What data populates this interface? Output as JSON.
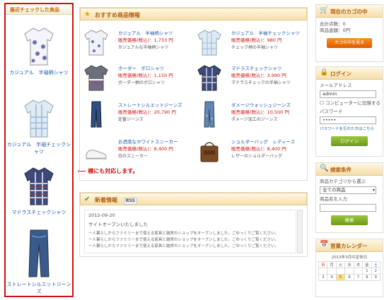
{
  "left_column": {
    "title": "最近チェックした商品",
    "items": [
      {
        "label": "カジュアル　半袖柄シャツ"
      },
      {
        "label": "カジュアル　半袖チェックシャツ"
      },
      {
        "label": "マドラスチェックシャツ"
      },
      {
        "label": "ストレートシルエットジーンズ"
      }
    ]
  },
  "annotation": "横にも対応します。",
  "recommend": {
    "title": "おすすめ商品情報",
    "products": [
      {
        "name": "カジュアル　半袖柄シャツ",
        "price": "販売価格(税込)：1,733 円",
        "desc": "カジュアルな半袖柄シャツ",
        "thumb": "shirt-white"
      },
      {
        "name": "カジュアル　半袖チェックシャツ",
        "price": "販売価格(税込)：980 円",
        "desc": "チェック柄の半袖シャツ",
        "thumb": "shirt-check-blue"
      },
      {
        "name": "ボーダー　ポロシャツ",
        "price": "販売価格(税込)：1,150 円",
        "desc": "ボーダー柄のポロシャツ",
        "thumb": "polo-gray"
      },
      {
        "name": "マドラスチェックシャツ",
        "price": "販売価格(税込)：3,990 円",
        "desc": "マドラスチェックの半袖シャツ",
        "thumb": "shirt-madras"
      },
      {
        "name": "ストレートシルエットジーンズ",
        "price": "販売価格(税込)：20,790 円",
        "desc": "定番ジーンズ",
        "thumb": "jeans-dark"
      },
      {
        "name": "ダメージウォッシュジーンズ",
        "price": "販売価格(税込)：10,500 円",
        "desc": "ダメージ加工のジーンズ",
        "thumb": "jeans-light"
      },
      {
        "name": "お洒落なホワイトスニーカー",
        "price": "販売価格(税込)：8,400 円",
        "desc": "白のスニーカー",
        "thumb": "sneaker-white"
      },
      {
        "name": "ショルダーバッグ　レディース",
        "price": "販売価格(税込)：8,400 円",
        "desc": "レザーのショルダーバッグ",
        "thumb": "bag-brown"
      }
    ]
  },
  "news": {
    "title": "新着情報",
    "rss": "RSS",
    "date": "2012-09-20",
    "headline": "サイトオープンいたしました",
    "lines": [
      "一人暮らしからファミリーまで使える家具と雑貨のショップをオープンしました。ごゆっくりご覧ください。",
      "一人暮らしからファミリーまで使える家具と雑貨のショップをオープンしました。ごゆっくりご覧ください。",
      "一人暮らしからファミリーまで使える家具と雑貨のショップをオープンしました。ごゆっくりご覧ください。"
    ]
  },
  "cart": {
    "title": "現在のカゴの中",
    "count_label": "合計点数：0",
    "total_label": "商品金額：0円",
    "button": "カゴの中を見る"
  },
  "login": {
    "title": "ログイン",
    "email_label": "メールアドレス",
    "email_value": "admin",
    "remember_label": "コンピューターに記憶する",
    "password_label": "パスワード",
    "password_value": "•••••",
    "forgot_label": "パスワードを忘れた方はこちら",
    "button": "ログイン"
  },
  "search": {
    "title": "検索条件",
    "category_label": "商品カテゴリから選ぶ",
    "category_value": "全ての商品",
    "keyword_label": "商品名を入力",
    "button": "検索"
  },
  "calendar": {
    "title": "営業カレンダー",
    "month": "2013年3月の定休日",
    "days": [
      "日",
      "月",
      "火",
      "水",
      "木",
      "金",
      "土"
    ],
    "rows": [
      [
        "",
        "",
        "",
        "",
        "",
        "1",
        "2"
      ],
      [
        "3",
        "4",
        "5",
        "6",
        "7",
        "8",
        "9"
      ]
    ]
  },
  "colors": {
    "accent": "#b26010",
    "link": "#1e5aa8",
    "price": "#d01010",
    "highlight_border": "#d01010"
  }
}
